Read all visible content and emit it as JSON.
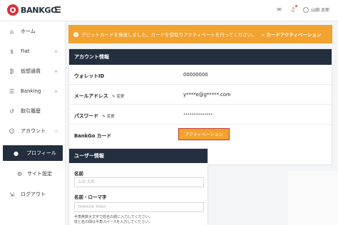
{
  "header": {
    "logo_text": "BANKGO",
    "username": "山田 太郎",
    "icons": [
      "mail-icon",
      "bell-icon",
      "user-icon"
    ]
  },
  "sidebar": {
    "items": [
      {
        "label": "ホーム",
        "icon": "home-icon"
      },
      {
        "label": "Fiat",
        "icon": "dollar-icon",
        "expand": "+"
      },
      {
        "label": "仮想通貨",
        "icon": "bitcoin-icon",
        "expand": "+"
      },
      {
        "label": "Banking",
        "icon": "bank-icon",
        "expand": "+"
      },
      {
        "label": "取引履歴",
        "icon": "history-icon"
      },
      {
        "label": "アカウント",
        "icon": "account-icon",
        "expand": "−"
      },
      {
        "label": "プロフィール",
        "icon": "profile-icon"
      },
      {
        "label": "サイト設定",
        "icon": "settings-icon"
      },
      {
        "label": "ログアウト",
        "icon": "logout-icon"
      }
    ]
  },
  "banner": {
    "message": "デビットカードを発送しました。カードを受取りアクティベートを行ってください。",
    "link": "» カードアクティベーション",
    "color": "#f2a22e"
  },
  "account": {
    "title": "アカウント情報",
    "rows": [
      {
        "label": "ウォレットID",
        "value": "00000000"
      },
      {
        "label": "メールアドレス",
        "edit": "変更",
        "value": "y****e@g*****.com"
      },
      {
        "label": "パスワード",
        "edit": "変更",
        "value": "••••••••••••••"
      },
      {
        "label": "BankGo カード"
      }
    ],
    "activate_button": "アクティベーション"
  },
  "userinfo": {
    "title": "ユーザー情報",
    "name_label": "名前",
    "name_placeholder": "山田 太郎",
    "roma_label": "名前・ローマ字",
    "roma_note_1": "半角英数大文字で姓名の順に入力してください。",
    "roma_note_2": "姓と名の間は半角スペースを入力してください。",
    "roma_placeholder": "YAMADA TARO"
  },
  "colors": {
    "navy": "#232f3e",
    "accent": "#f2a22e",
    "highlight": "#c0392b"
  }
}
